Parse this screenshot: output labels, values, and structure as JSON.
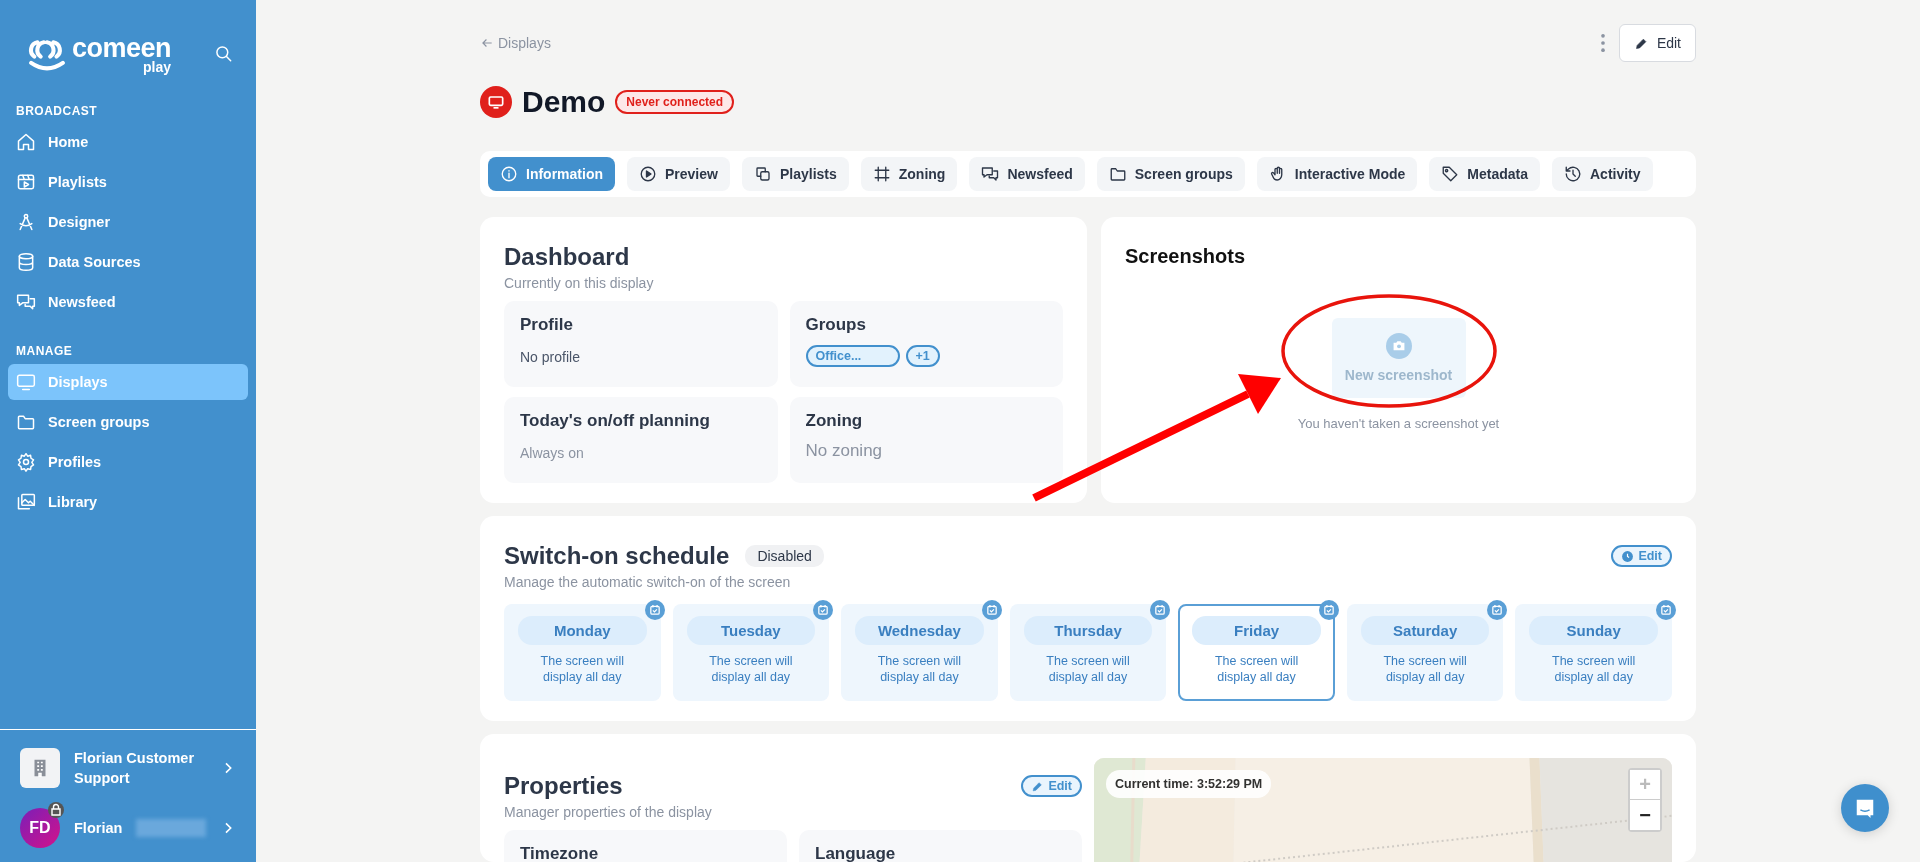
{
  "sidebar": {
    "logo": {
      "name": "comeen",
      "sub": "play"
    },
    "sections": [
      {
        "title": "BROADCAST",
        "items": [
          {
            "label": "Home",
            "selected": false
          },
          {
            "label": "Playlists",
            "selected": false
          },
          {
            "label": "Designer",
            "selected": false
          },
          {
            "label": "Data Sources",
            "selected": false
          },
          {
            "label": "Newsfeed",
            "selected": false
          }
        ]
      },
      {
        "title": "MANAGE",
        "items": [
          {
            "label": "Displays",
            "selected": true
          },
          {
            "label": "Screen groups",
            "selected": false
          },
          {
            "label": "Profiles",
            "selected": false
          },
          {
            "label": "Library",
            "selected": false
          }
        ]
      }
    ],
    "organization": {
      "name": "Florian Customer Support"
    },
    "user": {
      "initials": "FD",
      "name": "Florian",
      "surname_hidden": true
    }
  },
  "header": {
    "back": "Displays",
    "edit": "Edit",
    "title": "Demo",
    "status": "Never connected"
  },
  "tabs": [
    {
      "label": "Information",
      "selected": true
    },
    {
      "label": "Preview",
      "selected": false
    },
    {
      "label": "Playlists",
      "selected": false
    },
    {
      "label": "Zoning",
      "selected": false
    },
    {
      "label": "Newsfeed",
      "selected": false
    },
    {
      "label": "Screen groups",
      "selected": false
    },
    {
      "label": "Interactive Mode",
      "selected": false
    },
    {
      "label": "Metadata",
      "selected": false
    },
    {
      "label": "Activity",
      "selected": false
    }
  ],
  "dashboard": {
    "title": "Dashboard",
    "subtitle": "Currently on this display",
    "tiles": [
      {
        "kind": "text",
        "title": "Profile",
        "value": "No profile"
      },
      {
        "kind": "tags",
        "title": "Groups",
        "tags": [
          "Office...",
          "+1"
        ]
      },
      {
        "kind": "text",
        "title": "Today's on/off planning",
        "value": "Always on"
      },
      {
        "kind": "text",
        "title": "Zoning",
        "value": "No zoning"
      }
    ]
  },
  "screenshots": {
    "title": "Screenshots",
    "button": "New screenshot",
    "disabled": true,
    "empty": "You haven't taken a screenshot yet"
  },
  "schedule": {
    "title": "Switch-on schedule",
    "badge": "Disabled",
    "subtitle": "Manage the automatic switch-on of the screen",
    "edit": "Edit",
    "days": [
      {
        "label": "Monday",
        "text": "The screen will display all day",
        "selected": false
      },
      {
        "label": "Tuesday",
        "text": "The screen will display all day",
        "selected": false
      },
      {
        "label": "Wednesday",
        "text": "The screen will display all day",
        "selected": false
      },
      {
        "label": "Thursday",
        "text": "The screen will display all day",
        "selected": false
      },
      {
        "label": "Friday",
        "text": "The screen will display all day",
        "selected": true
      },
      {
        "label": "Saturday",
        "text": "The screen will display all day",
        "selected": false
      },
      {
        "label": "Sunday",
        "text": "The screen will display all day",
        "selected": false
      }
    ]
  },
  "properties": {
    "title": "Properties",
    "subtitle": "Manager properties of the display",
    "edit": "Edit",
    "tiles": [
      {
        "title": "Timezone"
      },
      {
        "title": "Language"
      }
    ],
    "map": {
      "kind": "picture",
      "current_time": "Current time: 3:52:29 PM",
      "zoom_in": "+",
      "zoom_out": "−"
    }
  }
}
